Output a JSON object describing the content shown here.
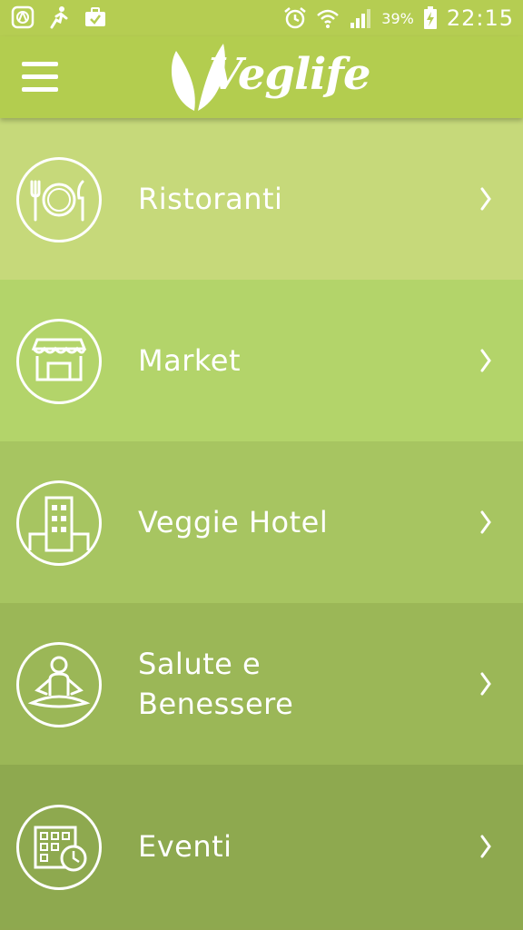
{
  "status_bar": {
    "battery_percent": "39%",
    "time": "22:15",
    "icons": [
      "android-icon",
      "activity-icon",
      "briefcase-check-icon",
      "alarm-icon",
      "wifi-icon",
      "signal-icon",
      "battery-charging-icon"
    ]
  },
  "app_bar": {
    "menu_icon": "hamburger-icon",
    "logo_text": "Veglife"
  },
  "menu": {
    "items": [
      {
        "label": "Ristoranti",
        "icon": "restaurant-plate-icon"
      },
      {
        "label": "Market",
        "icon": "market-storefront-icon"
      },
      {
        "label": "Veggie Hotel",
        "icon": "hotel-building-icon"
      },
      {
        "label": "Salute e Benessere",
        "icon": "meditation-person-icon"
      },
      {
        "label": "Eventi",
        "icon": "calendar-clock-icon"
      }
    ],
    "chevron_icon": "chevron-right-icon"
  },
  "colors": {
    "app_bar": "#b3cd4f",
    "row_1": "#c6d97a",
    "row_2": "#b3d46a",
    "row_3": "#a7c561",
    "row_4": "#9bb757",
    "row_5": "#8ea94f",
    "foreground": "#ffffff"
  }
}
